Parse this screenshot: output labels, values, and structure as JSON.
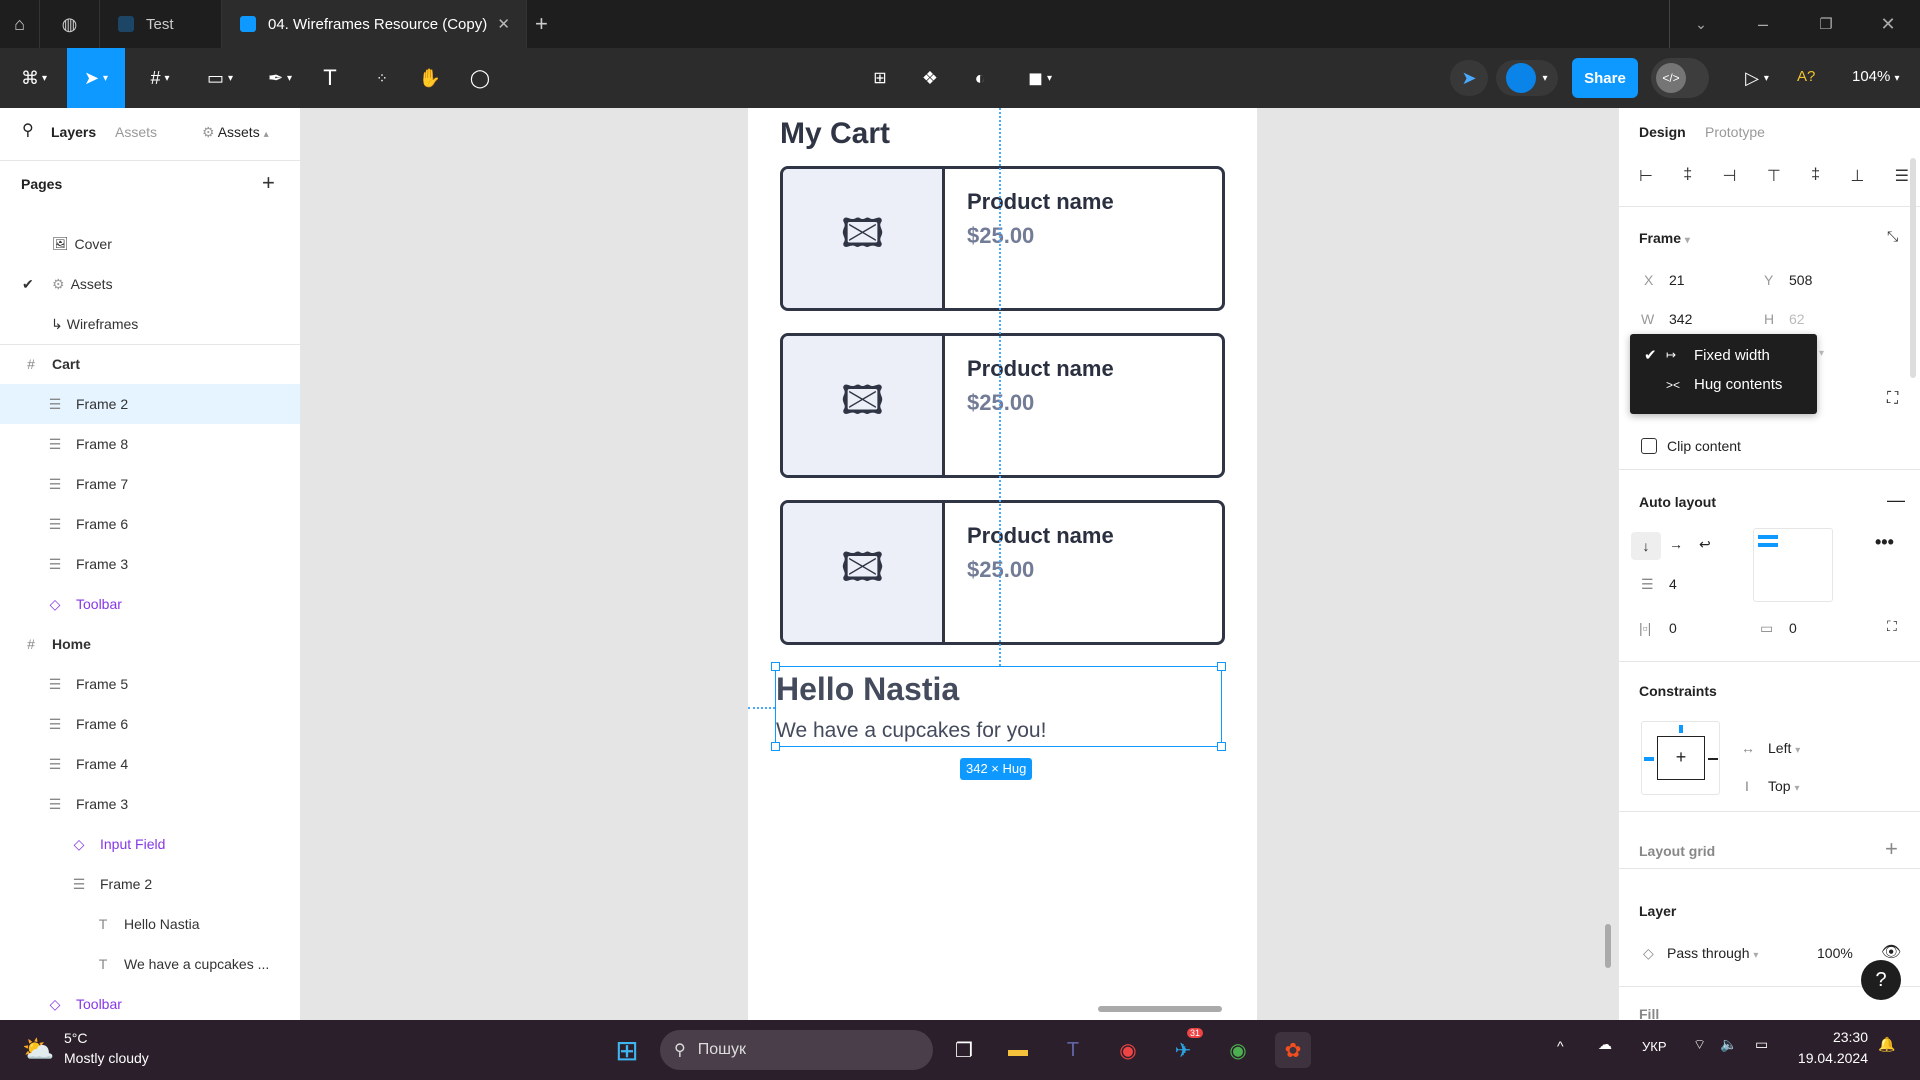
{
  "tabs": {
    "test": "Test",
    "active": "04. Wireframes Resource (Copy)"
  },
  "toolbar": {
    "share": "Share",
    "zoom": "104%",
    "missing_fonts": "A?"
  },
  "left": {
    "tab_layers": "Layers",
    "tab_assets": "Assets",
    "page_select": "Assets",
    "pages_title": "Pages",
    "pages": [
      {
        "label": "Cover",
        "icon": "🖼"
      },
      {
        "label": "Assets",
        "icon": "⚙"
      },
      {
        "label": "Wireframes",
        "icon": "↳"
      }
    ],
    "layers": [
      {
        "label": "Cart",
        "type": "frame"
      },
      {
        "label": "Frame 2",
        "type": "autolayout"
      },
      {
        "label": "Frame 8",
        "type": "autolayout"
      },
      {
        "label": "Frame 7",
        "type": "autolayout"
      },
      {
        "label": "Frame 6",
        "type": "autolayout"
      },
      {
        "label": "Frame 3",
        "type": "autolayout"
      },
      {
        "label": "Toolbar",
        "type": "instance"
      },
      {
        "label": "Home",
        "type": "frame"
      },
      {
        "label": "Frame 5",
        "type": "autolayout"
      },
      {
        "label": "Frame 6",
        "type": "autolayout"
      },
      {
        "label": "Frame 4",
        "type": "autolayout"
      },
      {
        "label": "Frame 3",
        "type": "autolayout"
      },
      {
        "label": "Input Field",
        "type": "instance"
      },
      {
        "label": "Frame 2",
        "type": "autolayout"
      },
      {
        "label": "Hello Nastia",
        "type": "text"
      },
      {
        "label": "We have a cupcakes ...",
        "type": "text"
      },
      {
        "label": "Toolbar",
        "type": "instance"
      }
    ]
  },
  "canvas": {
    "title": "My Cart",
    "products": [
      {
        "name": "Product name",
        "price": "$25.00"
      },
      {
        "name": "Product name",
        "price": "$25.00"
      },
      {
        "name": "Product name",
        "price": "$25.00"
      }
    ],
    "greeting": "Hello Nastia",
    "subtitle": "We have a cupcakes for you!",
    "size_badge": "342 × Hug"
  },
  "right": {
    "tab_design": "Design",
    "tab_prototype": "Prototype",
    "frame_title": "Frame",
    "x_label": "X",
    "x": "21",
    "y_label": "Y",
    "y": "508",
    "w_label": "W",
    "w": "342",
    "h_label": "H",
    "h": "62",
    "width_menu": [
      {
        "label": "Fixed width",
        "checked": true
      },
      {
        "label": "Hug contents",
        "checked": false
      }
    ],
    "clip_content": "Clip content",
    "auto_layout": "Auto layout",
    "gap": "4",
    "pad_h": "0",
    "pad_v": "0",
    "constraints": "Constraints",
    "constraint_h": "Left",
    "constraint_v": "Top",
    "layout_grid": "Layout grid",
    "layer": "Layer",
    "blend": "Pass through",
    "opacity": "100%",
    "fill": "Fill"
  },
  "taskbar": {
    "temp": "5°C",
    "weather": "Mostly cloudy",
    "search": "Пошук",
    "lang": "УКР",
    "time": "23:30",
    "date": "19.04.2024",
    "telegram_badge": "31"
  },
  "colors": {
    "accent": "#0d99ff",
    "component": "#8638e5"
  }
}
